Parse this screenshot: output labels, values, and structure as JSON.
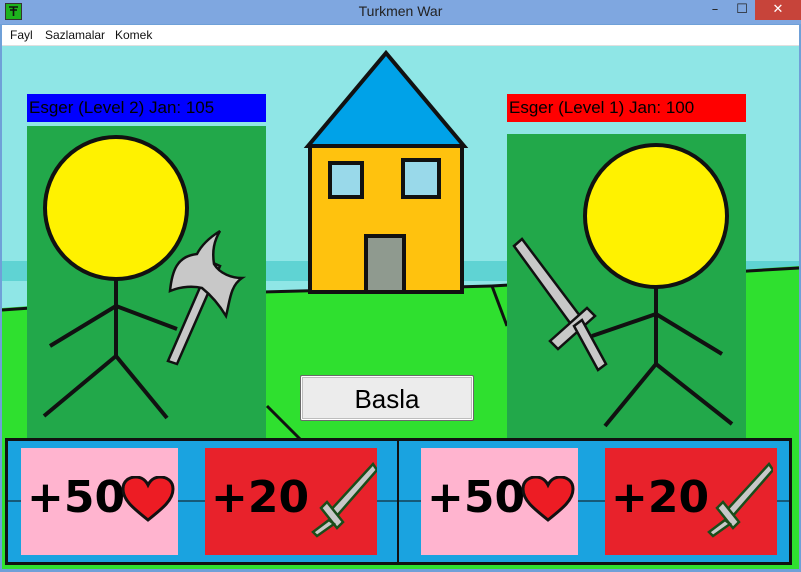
{
  "window": {
    "title": "Turkmen War",
    "minimize": "–",
    "maximize": "☐",
    "close": "✕"
  },
  "menu": {
    "items": [
      "Fayl",
      "Sazlamalar",
      "Komek"
    ]
  },
  "players": {
    "left": {
      "label": "Esger (Level 2) Jan: 105",
      "bar_color": "#0000ff"
    },
    "right": {
      "label": "Esger (Level 1) Jan: 100",
      "bar_color": "#ff0000"
    }
  },
  "start_button": {
    "label": "Basla"
  },
  "cards": {
    "left_heal": {
      "text": "+50",
      "icon": "heart-icon"
    },
    "left_attack": {
      "text": "+20",
      "icon": "sword-icon"
    },
    "right_heal": {
      "text": "+50",
      "icon": "heart-icon"
    },
    "right_attack": {
      "text": "+20",
      "icon": "sword-icon"
    }
  },
  "colors": {
    "sky": "#8fe6e6",
    "grass": "#2fe02f",
    "player_bg": "#22a84a",
    "head": "#fff200",
    "house_wall": "#ffc20e",
    "house_roof": "#00a2e8",
    "panel": "#1aa3e0",
    "heal_card": "#ffb4cf",
    "attack_card": "#e8222b"
  }
}
